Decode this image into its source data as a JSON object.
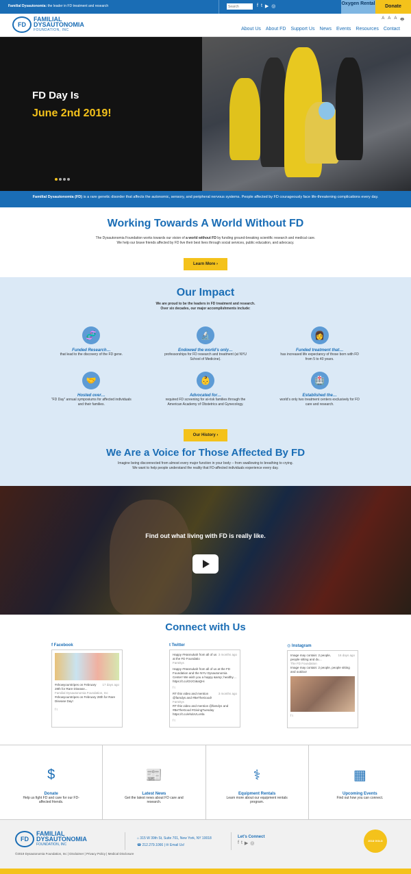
{
  "topbar": {
    "tag_bold": "Familial Dysautonomia:",
    "tag_rest": " the leader in FD treatment and research",
    "search_placeholder": "Search",
    "social": [
      "f",
      "t",
      "▶",
      "◎"
    ],
    "oxygen_label": "Oxygen Rental",
    "donate_label": "Donate"
  },
  "header": {
    "logo_mark": "FD",
    "logo_line1": "FAMILIAL",
    "logo_line2": "DYSAUTONOMIA",
    "logo_line3": "FOUNDATION, INC",
    "utils": [
      "A",
      "A",
      "A",
      "🖶"
    ],
    "nav": [
      "About Us",
      "About FD",
      "Support Us",
      "News",
      "Events",
      "Resources",
      "Contact"
    ]
  },
  "hero": {
    "title": "FD Day Is",
    "date": "June 2nd 2019!",
    "dots": 4,
    "active_dot": 0
  },
  "band": {
    "bold": "Familial Dysautonomia (FD)",
    "text": " is a rare genetic disorder that affects the autonomic, sensory, and peripheral nervous systems. People affected by FD courageously face life-threatening complications every day."
  },
  "mission": {
    "title": "Working Towards A World Without FD",
    "p1_a": "The Dysautonomia Foundation works towards our vision of ",
    "p1_b": "a world without FD",
    "p1_c": " by funding ground-breaking scientific research and medical care.",
    "p2": "We help our brave friends affected by FD live their best lives through social services, public education, and advocacy.",
    "button": "Learn More ›"
  },
  "impact": {
    "title": "Our Impact",
    "sub1": "We are proud to be the leaders in FD treatment and research.",
    "sub2": "Over six decades, our major accomplishments include:",
    "items": [
      {
        "icon": "🧬",
        "title": "Funded Research…",
        "desc": "that lead to the discovery of the FD gene."
      },
      {
        "icon": "🔬",
        "title": "Endowed the world’s only…",
        "desc": "professorships for FD research and treatment (at NYU School of Medicine)."
      },
      {
        "icon": "👩",
        "title": "Funded treatment that…",
        "desc": "has increased life expectancy of those born with FD from 5 to 40 years."
      },
      {
        "icon": "🤝",
        "title": "Hosted over…",
        "desc": "“FD Day” annual symposiums for affected individuals and their families."
      },
      {
        "icon": "👶",
        "title": "Advocated for…",
        "desc": "required FD screening for at-risk families through the American Academy of Obstetrics and Gynecology."
      },
      {
        "icon": "🏥",
        "title": "Established the…",
        "desc": "world’s only two treatment centers exclusively for FD care and research."
      }
    ],
    "button": "Our History ›",
    "voice_title": "We Are a Voice for Those Affected By FD",
    "voice_p1": "Imagine being disconnected from almost every major function in your body -- from swallowing to breathing to crying.",
    "voice_p2": "We want to help people understand the reality that FD-affected individuals experience every day."
  },
  "video": {
    "caption": "Find out what living with FD is really like."
  },
  "connect": {
    "title": "Connect with Us",
    "facebook": {
      "label": "Facebook",
      "date": "17 days ago",
      "post": "#showyourstripes on February 28th for Rare Disease...",
      "source": "Familial Dysautonomia Foundation, Inc",
      "body": "#showyourstripes on February 28th for Rare Disease Day!"
    },
    "twitter": {
      "label": "Twitter",
      "t1_time": "3 months ago",
      "t1_title": "Happy #Hannukah from all of us at the FD Foundatio",
      "t1_user": "FamDys",
      "t1_body": "Happy #Hannukah from all of us at the FD Foundation and the NYU Dysautonomia Center! We wish you a happy &amp; healthy… https://t.co/OrzGi6aQHi",
      "t2_time": "3 months ago",
      "t2_title": "RT this video and mention @famdys and #BeTheGood!",
      "t2_user": "FamDys",
      "t2_body": "RT this video and mention @famdys and #BeTheGood #GivingTuesday https://t.co/ehdoVLxHla"
    },
    "instagram": {
      "label": "Instagram",
      "time": "16 days ago",
      "title": "Image may contain: 2 people, people sitting and du…",
      "source": "The FD Foundation",
      "body": "Image may contain: 2 people, people sitting and outdoor"
    }
  },
  "services": [
    {
      "icon": "$",
      "title": "Donate",
      "desc": "Help us fight FD and care for our FD-affected friends."
    },
    {
      "icon": "📰",
      "title": "Latest News",
      "desc": "Get the latest news about FD care and research."
    },
    {
      "icon": "⚕",
      "title": "Equipment Rentals",
      "desc": "Learn more about our equipment rentals program."
    },
    {
      "icon": "▦",
      "title": "Upcoming Events",
      "desc": "Find out how you can connect."
    }
  ],
  "footer": {
    "address": "315 W 39th St, Suite 701, New York, NY 10018",
    "phone": "212.279.1066",
    "email": "Email Us!",
    "lets_connect": "Let’s Connect",
    "social": [
      "f",
      "t",
      "▶",
      "◎"
    ],
    "badge": "2018 GOLD",
    "copyright": "©2019 Dysautonomia Foundation, Inc | Disclaimer | Privacy Policy | Medical Disclosure"
  },
  "colors": {
    "brand_blue": "#1a6db5",
    "accent_yellow": "#f4c21b",
    "light_blue": "#dbe9f6"
  }
}
